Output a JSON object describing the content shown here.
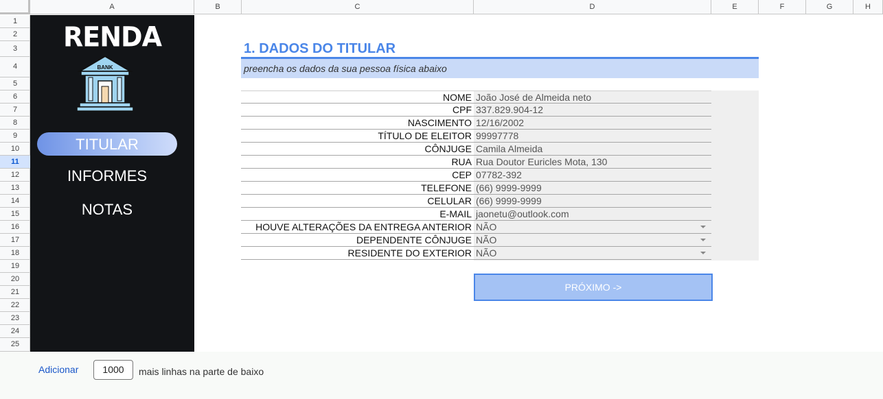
{
  "columns": [
    "A",
    "B",
    "C",
    "D",
    "E",
    "F",
    "G",
    "H"
  ],
  "rows": [
    "1",
    "2",
    "3",
    "4",
    "5",
    "6",
    "7",
    "8",
    "9",
    "10",
    "11",
    "12",
    "13",
    "14",
    "15",
    "16",
    "17",
    "18",
    "19",
    "20",
    "21",
    "22",
    "23",
    "24",
    "25"
  ],
  "active_row": "11",
  "sidebar": {
    "logo_text": "RENDA",
    "bank_icon_text": "BANK",
    "nav": [
      {
        "label": "TITULAR",
        "active": true
      },
      {
        "label": "INFORMES",
        "active": false
      },
      {
        "label": "NOTAS",
        "active": false
      }
    ]
  },
  "form": {
    "title": "1. DADOS DO TITULAR",
    "subtitle": "preencha os dados da sua pessoa física abaixo",
    "fields": [
      {
        "label": "NOME",
        "value": "João José de Almeida neto",
        "dropdown": false
      },
      {
        "label": "CPF",
        "value": "337.829.904-12",
        "dropdown": false
      },
      {
        "label": "NASCIMENTO",
        "value": "12/16/2002",
        "dropdown": false
      },
      {
        "label": "TÍTULO DE ELEITOR",
        "value": "99997778",
        "dropdown": false
      },
      {
        "label": "CÔNJUGE",
        "value": "Camila Almeida",
        "dropdown": false
      },
      {
        "label": "RUA",
        "value": "Rua Doutor Euricles Mota, 130",
        "dropdown": false
      },
      {
        "label": "CEP",
        "value": "07782-392",
        "dropdown": false
      },
      {
        "label": "TELEFONE",
        "value": "(66) 9999-9999",
        "dropdown": false
      },
      {
        "label": "CELULAR",
        "value": "(66) 9999-9999",
        "dropdown": false
      },
      {
        "label": "E-MAIL",
        "value": "jaonetu@outlook.com",
        "dropdown": false
      },
      {
        "label": "HOUVE ALTERAÇÕES DA ENTREGA ANTERIOR",
        "value": "NÃO",
        "dropdown": true
      },
      {
        "label": "DEPENDENTE CÔNJUGE",
        "value": "NÃO",
        "dropdown": true
      },
      {
        "label": "RESIDENTE DO EXTERIOR",
        "value": "NÃO",
        "dropdown": true
      }
    ],
    "next_button": "PRÓXIMO ->"
  },
  "footer": {
    "add_label": "Adicionar",
    "rows_value": "1000",
    "suffix": "mais linhas na parte de baixo"
  },
  "colors": {
    "accent": "#4a86e8",
    "sidebar_bg": "#121417",
    "band": "#c9daf8",
    "button": "#a4c2f4"
  }
}
